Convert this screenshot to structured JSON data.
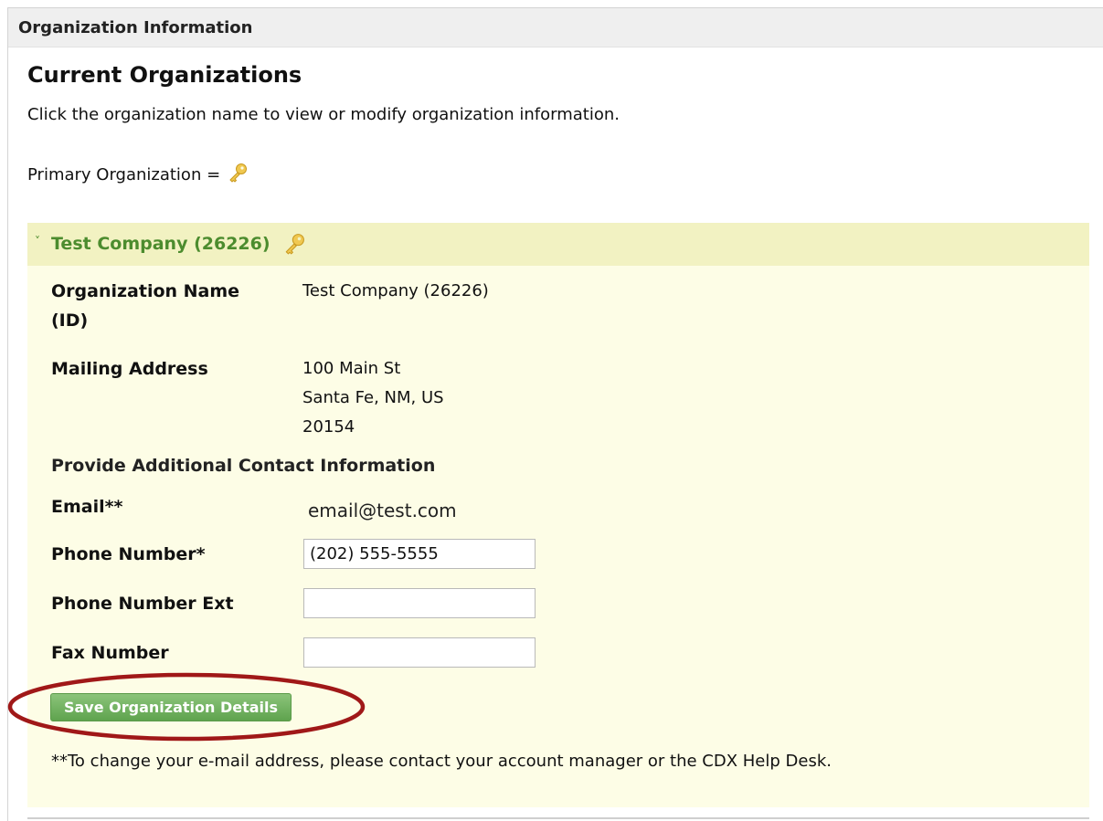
{
  "panel": {
    "title": "Organization Information"
  },
  "page": {
    "title": "Current Organizations",
    "intro": "Click the organization name to view or modify organization information.",
    "primary_label": "Primary Organization ="
  },
  "organization": {
    "header_title": "Test Company (26226)",
    "toggle_glyph": "˅",
    "fields": {
      "name_label_line1": "Organization Name",
      "name_label_line2": "(ID)",
      "name_value": "Test Company (26226)",
      "address_label": "Mailing Address",
      "address_line1": "100 Main St",
      "address_line2": "Santa Fe, NM, US",
      "address_line3": "20154"
    },
    "contact": {
      "section_title": "Provide Additional Contact Information",
      "email_label": "Email**",
      "email_value": "email@test.com",
      "phone_label": "Phone Number*",
      "phone_value": "(202) 555-5555",
      "ext_label": "Phone Number Ext",
      "ext_value": "",
      "fax_label": "Fax Number",
      "fax_value": ""
    },
    "save_button_label": "Save Organization Details",
    "footnote": "**To change your e-mail address, please contact your account manager or the CDX Help Desk."
  },
  "colors": {
    "header_bg": "#efefef",
    "org_header_bg": "#f2f2c2",
    "org_body_bg": "#fdfde6",
    "org_title": "#4c8c2e",
    "button_green": "#6aaa58",
    "annotation_red": "#a01818",
    "key_gold": "#e8b830"
  },
  "icons": {
    "primary_marker": "key-icon"
  }
}
